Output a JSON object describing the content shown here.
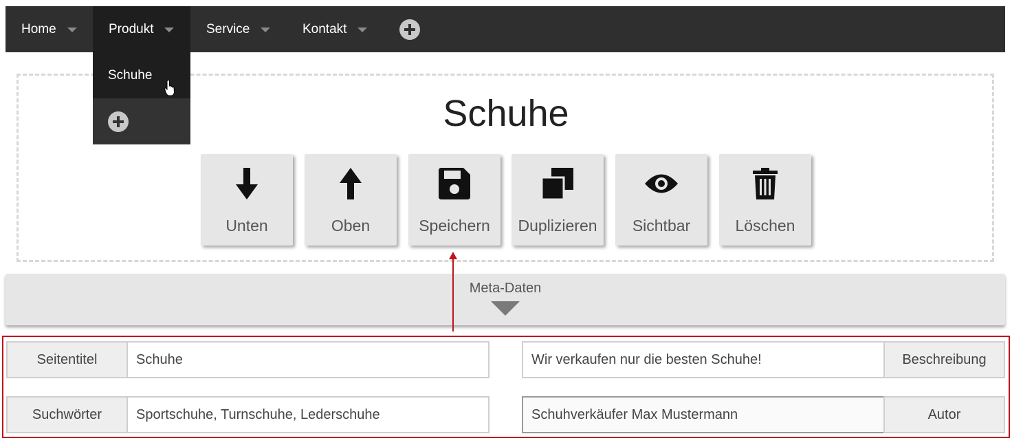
{
  "nav": {
    "items": [
      {
        "label": "Home"
      },
      {
        "label": "Produkt"
      },
      {
        "label": "Service"
      },
      {
        "label": "Kontakt"
      }
    ],
    "add_icon": "plus-circle-icon"
  },
  "dropdown": {
    "item": "Schuhe",
    "add_icon": "plus-circle-icon",
    "cursor_icon": "hand-pointer-icon"
  },
  "page": {
    "title": "Schuhe"
  },
  "toolbar": {
    "buttons": [
      {
        "label": "Unten",
        "icon": "arrow-down-icon"
      },
      {
        "label": "Oben",
        "icon": "arrow-up-icon"
      },
      {
        "label": "Speichern",
        "icon": "floppy-disk-icon"
      },
      {
        "label": "Duplizieren",
        "icon": "copy-icon"
      },
      {
        "label": "Sichtbar",
        "icon": "eye-icon"
      },
      {
        "label": "Löschen",
        "icon": "trash-icon"
      }
    ]
  },
  "meta": {
    "label": "Meta-Daten",
    "fields": {
      "seitentitel_label": "Seitentitel",
      "seitentitel_value": "Schuhe",
      "suchwoerter_label": "Suchwörter",
      "suchwoerter_value": "Sportschuhe, Turnschuhe, Lederschuhe",
      "beschreibung_label": "Beschreibung",
      "beschreibung_value": "Wir verkaufen nur die besten Schuhe!",
      "autor_label": "Autor",
      "autor_value": "Schuhverkäufer Max Mustermann"
    }
  },
  "colors": {
    "navbar": "#2f2f2f",
    "annotation": "#c0141c",
    "button_bg": "#e6e6e6"
  }
}
